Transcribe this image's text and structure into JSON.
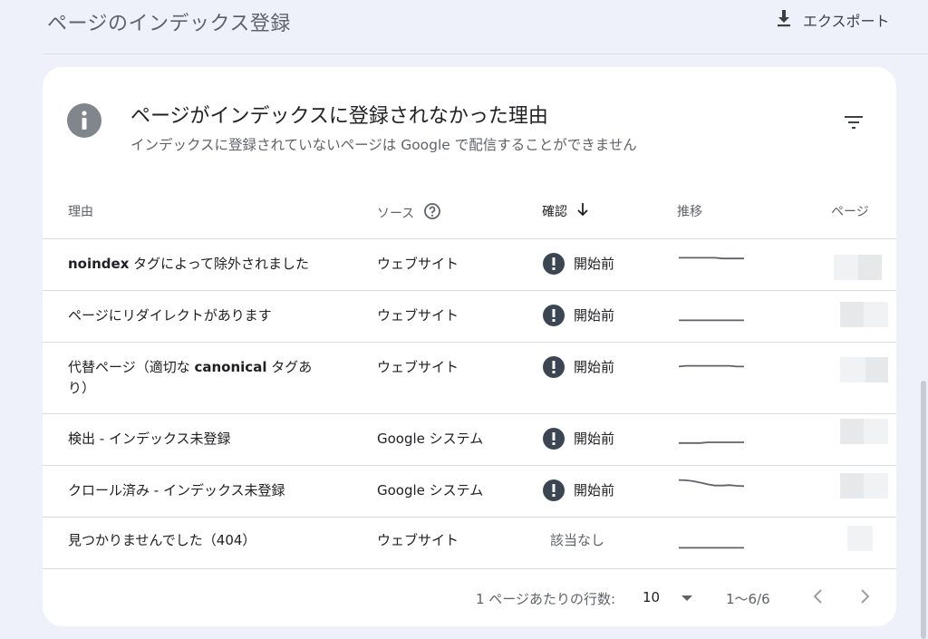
{
  "header": {
    "title": "ページのインデックス登録",
    "export_label": "エクスポート"
  },
  "card": {
    "title": "ページがインデックスに登録されなかった理由",
    "subtitle": "インデックスに登録されていないページは Google で配信することができません"
  },
  "table": {
    "columns": {
      "reason": "理由",
      "source": "ソース",
      "validation": "確認",
      "trend": "推移",
      "pages": "ページ"
    },
    "rows": [
      {
        "reason_bold": "noindex",
        "reason_rest": " タグによって除外されました",
        "source": "ウェブサイト",
        "status": "開始前",
        "status_kind": "alert",
        "trend": [
          0.85,
          0.85,
          0.85,
          0.85,
          0.85,
          0.85,
          0.8,
          0.8,
          0.8,
          0.8
        ]
      },
      {
        "reason_plain": "ページにリダイレクトがあります",
        "source": "ウェブサイト",
        "status": "開始前",
        "status_kind": "alert",
        "trend": [
          0.1,
          0.1,
          0.1,
          0.1,
          0.1,
          0.1,
          0.1,
          0.1,
          0.1,
          0.1
        ]
      },
      {
        "reason_pre": "代替ページ（適切な ",
        "reason_bold": "canonical",
        "reason_post": " タグあり）",
        "source": "ウェブサイト",
        "status": "開始前",
        "status_kind": "alert",
        "trend": [
          0.6,
          0.65,
          0.65,
          0.65,
          0.65,
          0.65,
          0.65,
          0.65,
          0.6,
          0.6
        ]
      },
      {
        "reason_plain": "検出 - インデックス未登録",
        "source": "Google システム",
        "status": "開始前",
        "status_kind": "alert",
        "trend": [
          0.2,
          0.2,
          0.2,
          0.2,
          0.25,
          0.25,
          0.25,
          0.25,
          0.25,
          0.25
        ]
      },
      {
        "reason_plain": "クロール済み - インデックス未登録",
        "source": "Google システム",
        "status": "開始前",
        "status_kind": "alert",
        "trend": [
          0.9,
          0.88,
          0.82,
          0.72,
          0.6,
          0.52,
          0.52,
          0.55,
          0.5,
          0.48
        ]
      },
      {
        "reason_plain": "見つかりませんでした（404）",
        "source": "ウェブサイト",
        "status": "該当なし",
        "status_kind": "none",
        "trend": [
          0.1,
          0.1,
          0.1,
          0.1,
          0.1,
          0.1,
          0.1,
          0.1,
          0.1,
          0.1
        ]
      }
    ]
  },
  "footer": {
    "rows_per_page_label": "1 ページあたりの行数:",
    "rows_per_page_value": "10",
    "range": "1〜6/6"
  },
  "colors": {
    "background": "#eef1fa",
    "status_icon": "#3c4653",
    "trend_line": "#5f6368"
  },
  "icons": {
    "export": "download-icon",
    "info": "info-icon",
    "filter": "filter-icon",
    "help": "help-circle-icon",
    "sort": "arrow-down-icon",
    "status": "exclamation-circle-icon",
    "dropdown": "caret-down-icon",
    "prev": "chevron-left-icon",
    "next": "chevron-right-icon"
  }
}
